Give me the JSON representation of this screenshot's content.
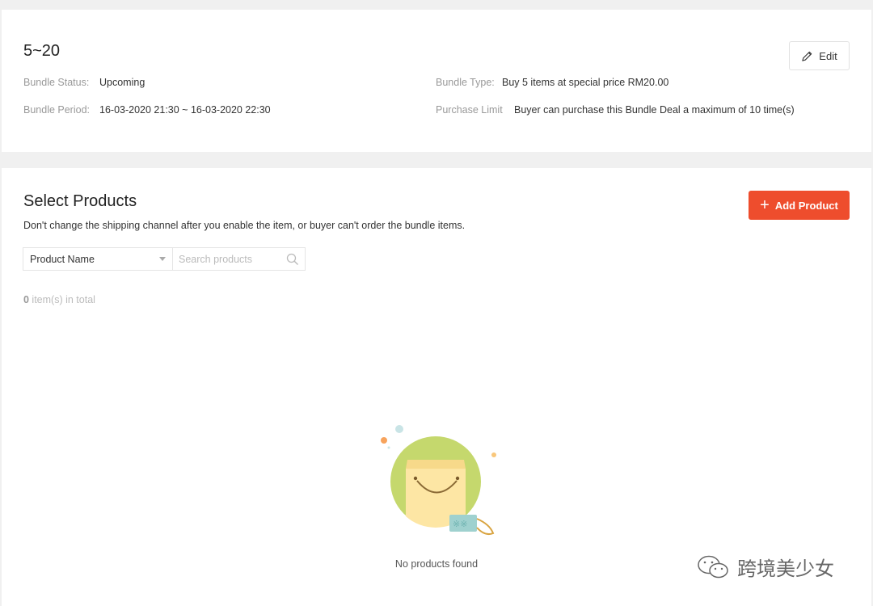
{
  "bundle": {
    "title": "5~20",
    "edit_label": "Edit",
    "status_label": "Bundle Status:",
    "status_value": "Upcoming",
    "period_label": "Bundle Period:",
    "period_value": "16-03-2020 21:30 ~ 16-03-2020 22:30",
    "type_label": "Bundle Type:",
    "type_value": "Buy 5 items at special price RM20.00",
    "limit_label": "Purchase Limit",
    "limit_value": "Buyer can purchase this Bundle Deal a maximum of 10 time(s)"
  },
  "products": {
    "title": "Select Products",
    "note": "Don't change the shipping channel after you enable the item, or buyer can't order the bundle items.",
    "add_label": "Add Product",
    "filter_selected": "Product Name",
    "search_placeholder": "Search products",
    "count_number": "0",
    "count_suffix": " item(s) in total",
    "empty_text": "No products found"
  },
  "watermark": {
    "text": "跨境美少女"
  },
  "colors": {
    "accent": "#ee4d2d",
    "background": "#f0f0f0",
    "illustration_circle": "#c5d86d"
  },
  "icons": [
    "pencil-icon",
    "plus-icon",
    "search-icon",
    "chevron-down-icon",
    "wechat-icon"
  ]
}
